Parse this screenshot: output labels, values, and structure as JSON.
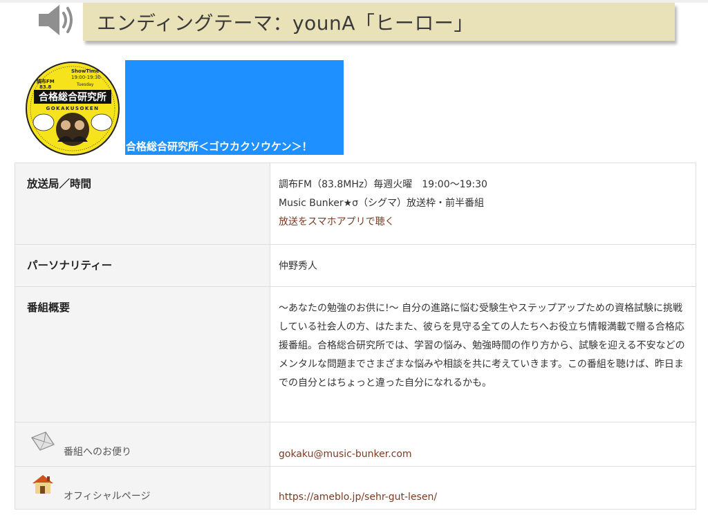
{
  "heading": {
    "title": "エンディングテーマ：younA「ヒーロー」",
    "icon": "speaker-icon"
  },
  "logo": {
    "icon": "gokakusoken-logo",
    "line1": "ShowTime",
    "line2": "19:00-19:30",
    "line3": "調布FM",
    "line4": "83.8",
    "line5": "Tuesday",
    "title": "合格総合研究所",
    "romaji": "GOKAKUSOKEN"
  },
  "program": {
    "title": "合格総合研究所＜ゴウカクソウケン＞！",
    "banner_color": "#1e90ff"
  },
  "table": {
    "broadcast": {
      "label": "放送局／時間",
      "line1": "調布FM（83.8MHz）毎週火曜　19:00～19:30",
      "line2": "Music Bunker★σ（シグマ）放送枠・前半番組",
      "app_link": "放送をスマホアプリで聴く"
    },
    "personality": {
      "label": "パーソナリティー",
      "value": "仲野秀人"
    },
    "overview": {
      "label": "番組概要",
      "text": "～あなたの勉強のお供に!～ 自分の進路に悩む受験生やステップアップための資格試験に挑戦している社会人の方、はたまた、彼らを見守る全ての人たちへお役立ち情報満載で贈る合格応援番組。合格総合研究所では、学習の悩み、勉強時間の作り方から、試験を迎える不安などのメンタルな問題までさまざまな悩みや相談を共に考えていきます。この番組を聴けば、昨日までの自分とはちょっと違った自分になれるかも。"
    },
    "mail": {
      "icon": "envelope-icon",
      "label": "番組へのお便り",
      "value": "gokaku@music-bunker.com"
    },
    "official": {
      "icon": "house-icon",
      "label": "オフィシャルページ",
      "value": "https://ameblo.jp/sehr-gut-lesen/"
    }
  },
  "colors": {
    "heading_bg": "#e9e1b7",
    "link": "#7a3a22",
    "label_bg": "#f4f4f4",
    "logo_yellow": "#f6e31c"
  }
}
